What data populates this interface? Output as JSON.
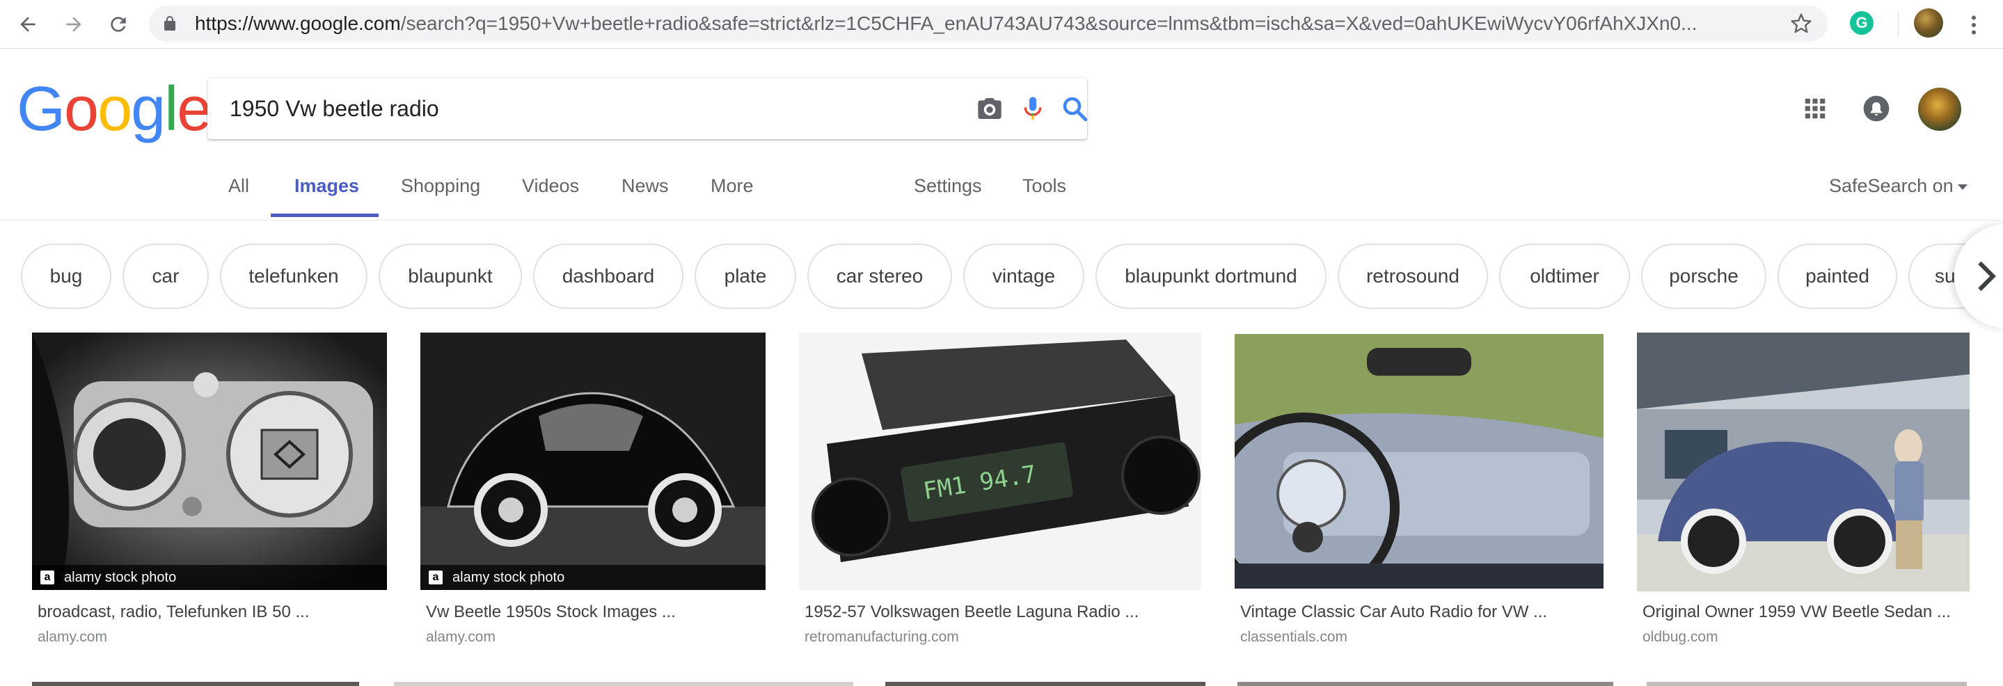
{
  "browser": {
    "url_domain": "https://www.google.com",
    "url_rest": "/search?q=1950+Vw+beetle+radio&safe=strict&rlz=1C5CHFA_enAU743AU743&source=lnms&tbm=isch&sa=X&ved=0ahUKEwiWycvY06rfAhXJXn0...",
    "extension_letter": "G"
  },
  "logo": [
    "G",
    "o",
    "o",
    "g",
    "l",
    "e"
  ],
  "search": {
    "query": "1950 Vw beetle radio"
  },
  "tabs": {
    "all": "All",
    "images": "Images",
    "shopping": "Shopping",
    "videos": "Videos",
    "news": "News",
    "more": "More",
    "settings": "Settings",
    "tools": "Tools"
  },
  "safesearch": "SafeSearch on",
  "chips": [
    "bug",
    "car",
    "telefunken",
    "blaupunkt",
    "dashboard",
    "plate",
    "car stereo",
    "vintage",
    "blaupunkt dortmund",
    "retrosound",
    "oldtimer",
    "porsche",
    "painted",
    "su"
  ],
  "results": [
    {
      "title": "broadcast, radio, Telefunken IB 50 ...",
      "site": "alamy.com",
      "watermark": "alamy stock photo"
    },
    {
      "title": "Vw Beetle 1950s Stock Images ...",
      "site": "alamy.com",
      "watermark": "alamy stock photo"
    },
    {
      "title": "1952-57 Volkswagen Beetle Laguna Radio ...",
      "site": "retromanufacturing.com",
      "display": "FM1  94.7"
    },
    {
      "title": "Vintage Classic Car Auto Radio for VW ...",
      "site": "classentials.com"
    },
    {
      "title": "Original Owner 1959 VW Beetle Sedan ...",
      "site": "oldbug.com"
    }
  ],
  "colors": {
    "google_blue": "#4285f4",
    "google_red": "#ea4335",
    "google_yellow": "#fbbc05",
    "google_green": "#34a853",
    "active_tab": "#4a5bc4"
  },
  "icons": [
    "back-icon",
    "forward-icon",
    "reload-icon",
    "lock-icon",
    "star-icon",
    "camera-icon",
    "mic-icon",
    "search-icon",
    "apps-grid-icon",
    "notifications-icon",
    "chevron-right-icon"
  ]
}
